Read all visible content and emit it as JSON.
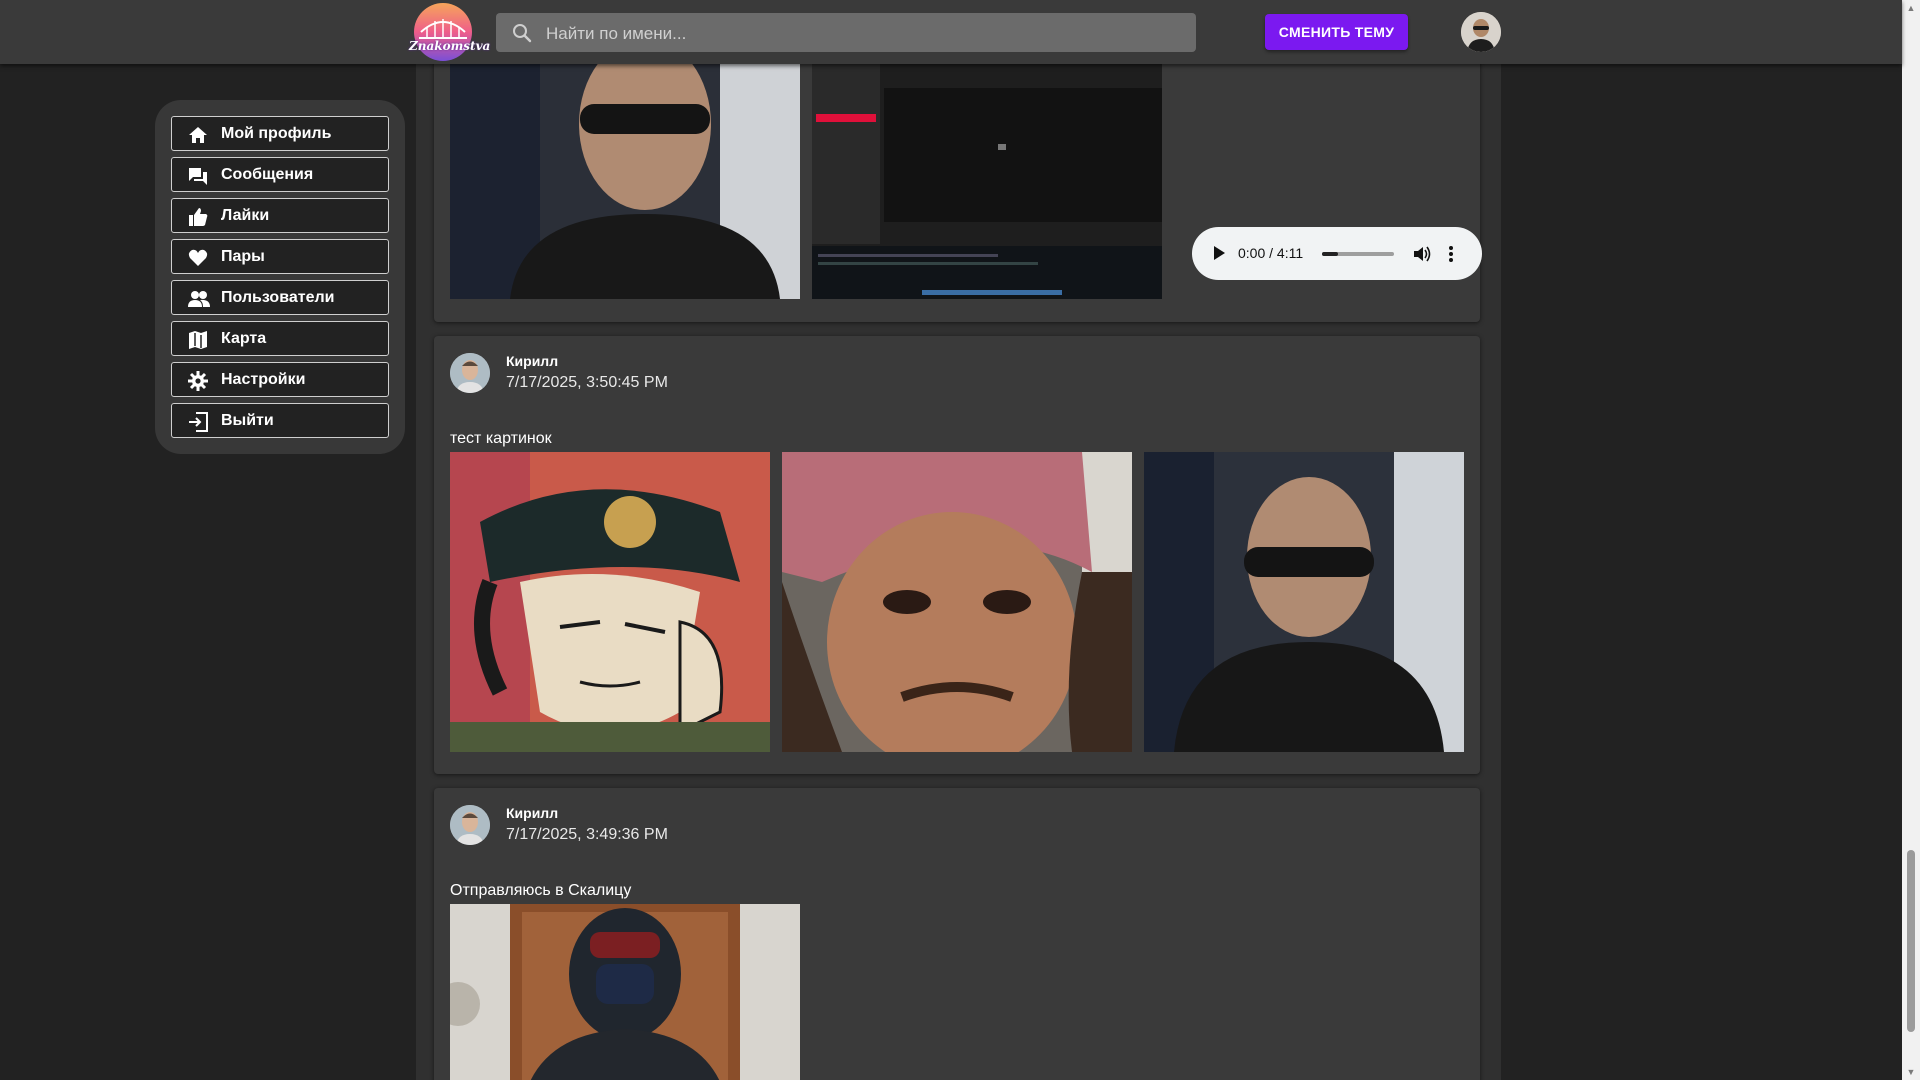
{
  "header": {
    "logo_text": "Znakomstva",
    "search": {
      "placeholder": "Найти по имени..."
    },
    "theme_button_label": "СМЕНИТЬ ТЕМУ"
  },
  "sidebar": {
    "items": [
      {
        "label": "Мой профиль",
        "icon": "home-icon"
      },
      {
        "label": "Сообщения",
        "icon": "messages-icon"
      },
      {
        "label": "Лайки",
        "icon": "thumb-up-icon"
      },
      {
        "label": "Пары",
        "icon": "heart-icon"
      },
      {
        "label": "Пользователи",
        "icon": "people-icon"
      },
      {
        "label": "Карта",
        "icon": "map-icon"
      },
      {
        "label": "Настройки",
        "icon": "gear-icon"
      },
      {
        "label": "Выйти",
        "icon": "logout-icon"
      }
    ]
  },
  "posts": [
    {
      "media": [
        "photo-man-sunglasses",
        "photo-screenshot"
      ],
      "audio": {
        "time": "0:00 / 4:11",
        "progress": 0.0
      }
    },
    {
      "author": "Кирилл",
      "timestamp": "7/17/2025, 3:50:45 PM",
      "text": "тест картинок",
      "media": [
        "photo-anime-character",
        "photo-pirate",
        "photo-man-sunglasses"
      ]
    },
    {
      "author": "Кирилл",
      "timestamp": "7/17/2025, 3:49:36 PM",
      "text": "Отправляюсь в Скалицу",
      "media": [
        "photo-person-in-hood"
      ]
    }
  ],
  "colors": {
    "accent": "#7b19f0",
    "page_background": "#222222",
    "panel_background": "#3a3a3a"
  }
}
